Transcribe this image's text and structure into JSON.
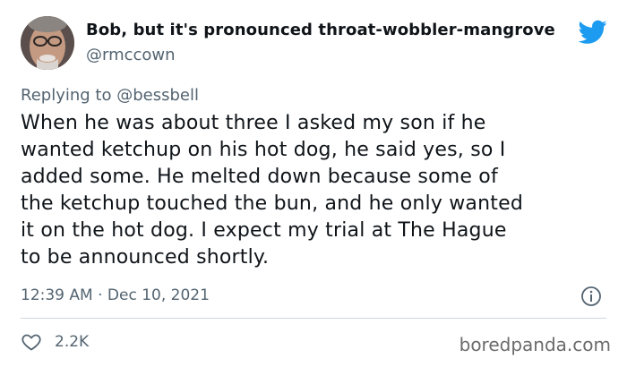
{
  "author": {
    "display_name": "Bob, but it's pronounced throat-wobbler-mangrove",
    "handle": "@rmccown"
  },
  "reply": {
    "prefix": "Replying to",
    "mention": "@bessbell"
  },
  "tweet": {
    "lines": [
      "When he was about three I asked my son if he",
      "wanted ketchup on his hot dog, he said yes, so I",
      "added some. He melted down because some of",
      "the ketchup touched the bun, and he only wanted",
      "it on the hot dog.  I expect my trial at The Hague",
      "to be announced shortly."
    ],
    "timestamp": "12:39 AM · Dec 10, 2021"
  },
  "stats": {
    "likes": "2.2K"
  },
  "watermark": "boredpanda.com",
  "icons": {
    "brand": "twitter-bird-icon",
    "info": "info-icon",
    "like": "heart-icon"
  },
  "colors": {
    "twitter_blue": "#1d9bf0",
    "secondary_text": "#536471",
    "divider": "#cfd9de"
  }
}
